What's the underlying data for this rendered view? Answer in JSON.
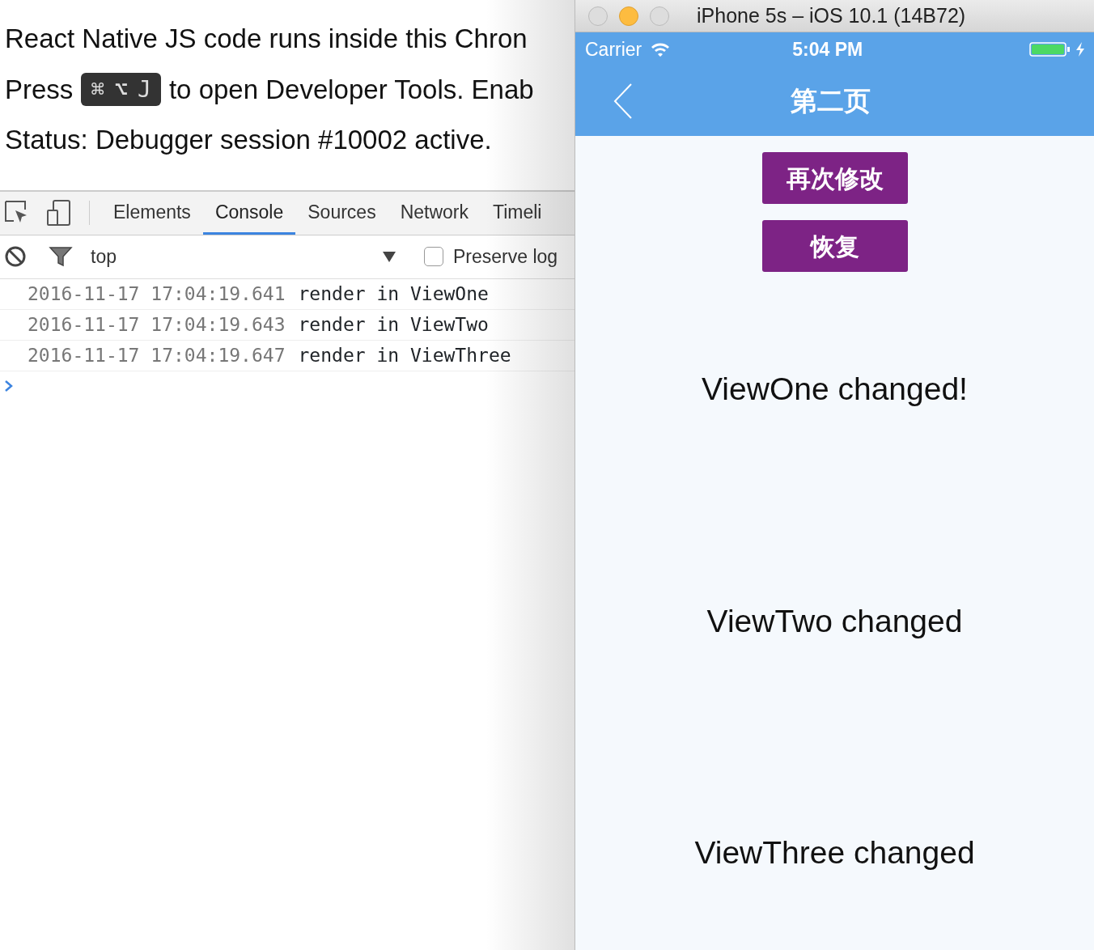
{
  "page": {
    "intro": "React Native JS code runs inside this Chron",
    "press_before": "Press",
    "keys": [
      "⌘",
      "⌥",
      "J"
    ],
    "press_after": "to open Developer Tools. Enab",
    "status": "Status: Debugger session #10002 active."
  },
  "devtools": {
    "tabs": [
      {
        "label": "Elements",
        "selected": false
      },
      {
        "label": "Console",
        "selected": true
      },
      {
        "label": "Sources",
        "selected": false
      },
      {
        "label": "Network",
        "selected": false
      },
      {
        "label": "Timeli",
        "selected": false
      }
    ],
    "context": "top",
    "preserve_log": {
      "label": "Preserve log",
      "checked": false
    },
    "log": [
      {
        "time": "2016-11-17 17:04:19.641",
        "message": "render in ViewOne"
      },
      {
        "time": "2016-11-17 17:04:19.643",
        "message": "render in ViewTwo"
      },
      {
        "time": "2016-11-17 17:04:19.647",
        "message": "render in ViewThree"
      }
    ]
  },
  "simulator": {
    "window": {
      "title": "iPhone 5s – iOS 10.1 (14B72)"
    },
    "status_bar": {
      "carrier": "Carrier",
      "time": "5:04 PM"
    },
    "nav_bar": {
      "title": "第二页"
    },
    "buttons": [
      "再次修改",
      "恢复"
    ],
    "texts": [
      "ViewOne changed!",
      "ViewTwo changed",
      "ViewThree changed"
    ]
  }
}
